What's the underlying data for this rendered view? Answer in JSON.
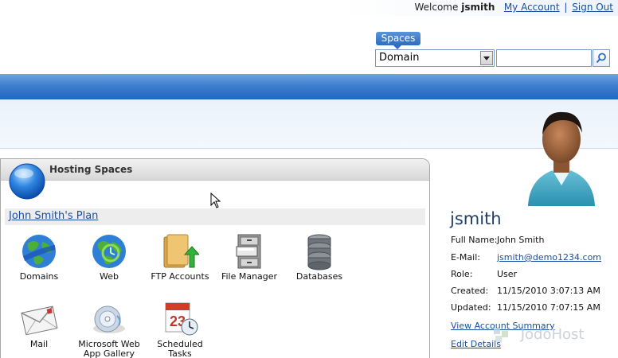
{
  "header": {
    "welcome_prefix": "Welcome",
    "username": "jsmith",
    "my_account": "My Account",
    "separator": "|",
    "sign_out": "Sign Out"
  },
  "search": {
    "tab_label": "Spaces",
    "selected_option": "Domain",
    "placeholder": ""
  },
  "hosting_spaces": {
    "title": "Hosting Spaces",
    "plan_link": "John Smith's Plan",
    "tiles": [
      {
        "label": "Domains",
        "icon": "globe-icon"
      },
      {
        "label": "Web",
        "icon": "web-globe-icon"
      },
      {
        "label": "FTP Accounts",
        "icon": "ftp-folder-icon"
      },
      {
        "label": "File Manager",
        "icon": "file-cabinet-icon"
      },
      {
        "label": "Databases",
        "icon": "database-icon"
      },
      {
        "label": "Mail",
        "icon": "mail-envelope-icon"
      },
      {
        "label": "Microsoft Web App Gallery",
        "icon": "web-app-gallery-icon"
      },
      {
        "label": "Scheduled Tasks",
        "icon": "calendar-clock-icon"
      }
    ]
  },
  "account": {
    "username": "jsmith",
    "full_name_label": "Full Name:",
    "full_name": "John Smith",
    "email_label": "E-Mail:",
    "email": "jsmith@demo1234.com",
    "role_label": "Role:",
    "role": "User",
    "created_label": "Created:",
    "created": "11/15/2010 3:07:13 AM",
    "updated_label": "Updated:",
    "updated": "11/15/2010 7:07:15 AM",
    "view_summary": "View Account Summary",
    "edit_details": "Edit Details"
  },
  "watermark": {
    "text": "JodoHost"
  },
  "colors": {
    "accent_blue": "#2d6cc0",
    "link_blue": "#1a4fa0",
    "header_bar": "#3f7fd0"
  }
}
